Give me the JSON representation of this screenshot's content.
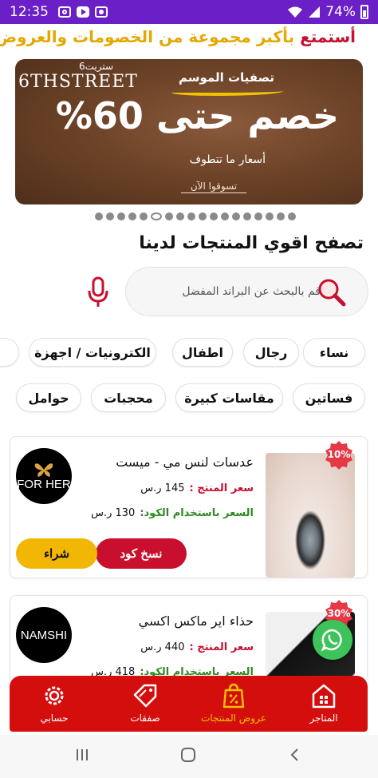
{
  "status_bar": {
    "time": "12:35",
    "battery": "74%",
    "left_icons": [
      "instagram-icon",
      "youtube-icon",
      "notification-icon"
    ],
    "right_icons": [
      "wifi-icon",
      "signal-icon",
      "battery-icon"
    ]
  },
  "headline": {
    "highlight": "أستمتع",
    "rest": "بأكبر مجموعة من الخصومات والعروض"
  },
  "banner": {
    "brand_en": "6THSTREET",
    "brand_ar": "6ستريت",
    "season_label": "تصفيات الموسم",
    "offer": "خصم حتى 60%",
    "subtitle": "أسعار ما تتطوف",
    "cta": "تسوقوا الآن"
  },
  "carousel": {
    "count": 18,
    "active_index": 5
  },
  "section_title": "تصفح اقوي المنتجات لدينا",
  "search": {
    "placeholder": "قم بالبحث عن البراند المفضل",
    "value": ""
  },
  "categories_row1": [
    "نساء",
    "رجال",
    "اطفال",
    "الكترونيات / اجهزة"
  ],
  "categories_row2": [
    "فساتين",
    "مقاسات كبيرة",
    "محجبات",
    "حوامل"
  ],
  "products": [
    {
      "name": "عدسات لنس مي - ميست",
      "discount": "10%",
      "brand": "FOR HER",
      "price_label": "سعر المنتج :",
      "price_value": "145 ر.س",
      "code_price_label": "السعر باستخدام الكود:",
      "code_price_value": "130 ر.س",
      "copy_button": "نسخ كود",
      "buy_button": "شراء"
    },
    {
      "name": "حذاء اير ماكس اكسي",
      "discount": "30%",
      "brand": "NAMSHI",
      "price_label": "سعر المنتج :",
      "price_value": "440 ر.س",
      "code_price_label": "السعر باستخدام الكود:",
      "code_price_value": "418 ر.س"
    }
  ],
  "bottom_nav": [
    {
      "label": "المتاجر",
      "icon": "store-icon"
    },
    {
      "label": "عروض المنتجات",
      "icon": "discount-bag-icon",
      "active": true
    },
    {
      "label": "صفقات",
      "icon": "deal-tag-icon"
    },
    {
      "label": "حسابي",
      "icon": "settings-gear-icon"
    }
  ],
  "colors": {
    "status_bar": "#6a1fc7",
    "accent_red": "#d40d0d",
    "accent_yellow": "#f2b705",
    "price_green": "#2e8b20",
    "whatsapp": "#3cc35a"
  }
}
